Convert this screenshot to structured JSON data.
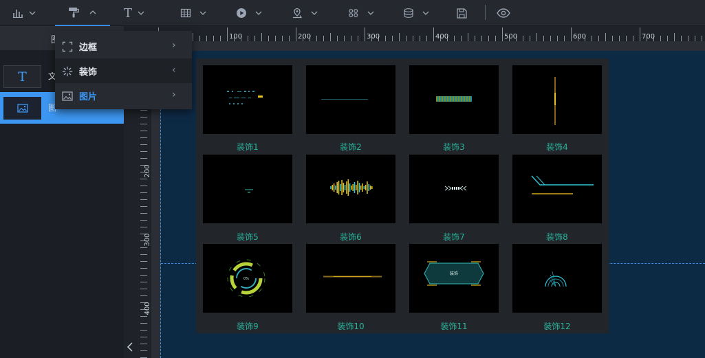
{
  "toolbar": {
    "items": [
      {
        "icon": "bar-chart-icon",
        "expanded": false
      },
      {
        "icon": "paint-roller-icon",
        "expanded": true
      },
      {
        "icon": "text-icon",
        "glyph": "T",
        "expanded": false
      },
      {
        "icon": "table-icon",
        "expanded": false
      },
      {
        "icon": "media-play-icon",
        "expanded": false
      },
      {
        "icon": "map-pin-icon",
        "expanded": false
      },
      {
        "icon": "grid-dots-icon",
        "expanded": false
      },
      {
        "icon": "database-icon",
        "expanded": false
      },
      {
        "icon": "save-icon"
      },
      {
        "icon": "preview-eye-icon"
      }
    ]
  },
  "left_panel": {
    "header_char": "图",
    "rows": [
      {
        "thumb_glyph": "T",
        "label": "文",
        "selected": false
      },
      {
        "thumb_icon": "image-icon",
        "label": "图",
        "selected": true
      }
    ]
  },
  "submenu": {
    "items": [
      {
        "label": "边框",
        "icon": "border-frame-icon",
        "arrow": "›"
      },
      {
        "label": "装饰",
        "icon": "decoration-icon",
        "arrow": "‹"
      },
      {
        "label": "图片",
        "icon": "image-icon",
        "arrow": "›"
      }
    ]
  },
  "ruler": {
    "top_labels": [
      "100",
      "200",
      "300",
      "400",
      "500",
      "600",
      "700"
    ],
    "left_labels": [
      "200",
      "300",
      "400"
    ]
  },
  "gallery": {
    "items": [
      {
        "label": "装饰1"
      },
      {
        "label": "装饰2"
      },
      {
        "label": "装饰3"
      },
      {
        "label": "装饰4"
      },
      {
        "label": "装饰5"
      },
      {
        "label": "装饰6"
      },
      {
        "label": "装饰7"
      },
      {
        "label": "装饰8"
      },
      {
        "label": "装饰9"
      },
      {
        "label": "装饰10"
      },
      {
        "label": "装饰11"
      },
      {
        "label": "装饰12"
      }
    ],
    "card11_text": "装饰"
  },
  "colors": {
    "accent": "#3d97f2",
    "caption": "#29b39a",
    "canvas": "#0d2a45"
  }
}
